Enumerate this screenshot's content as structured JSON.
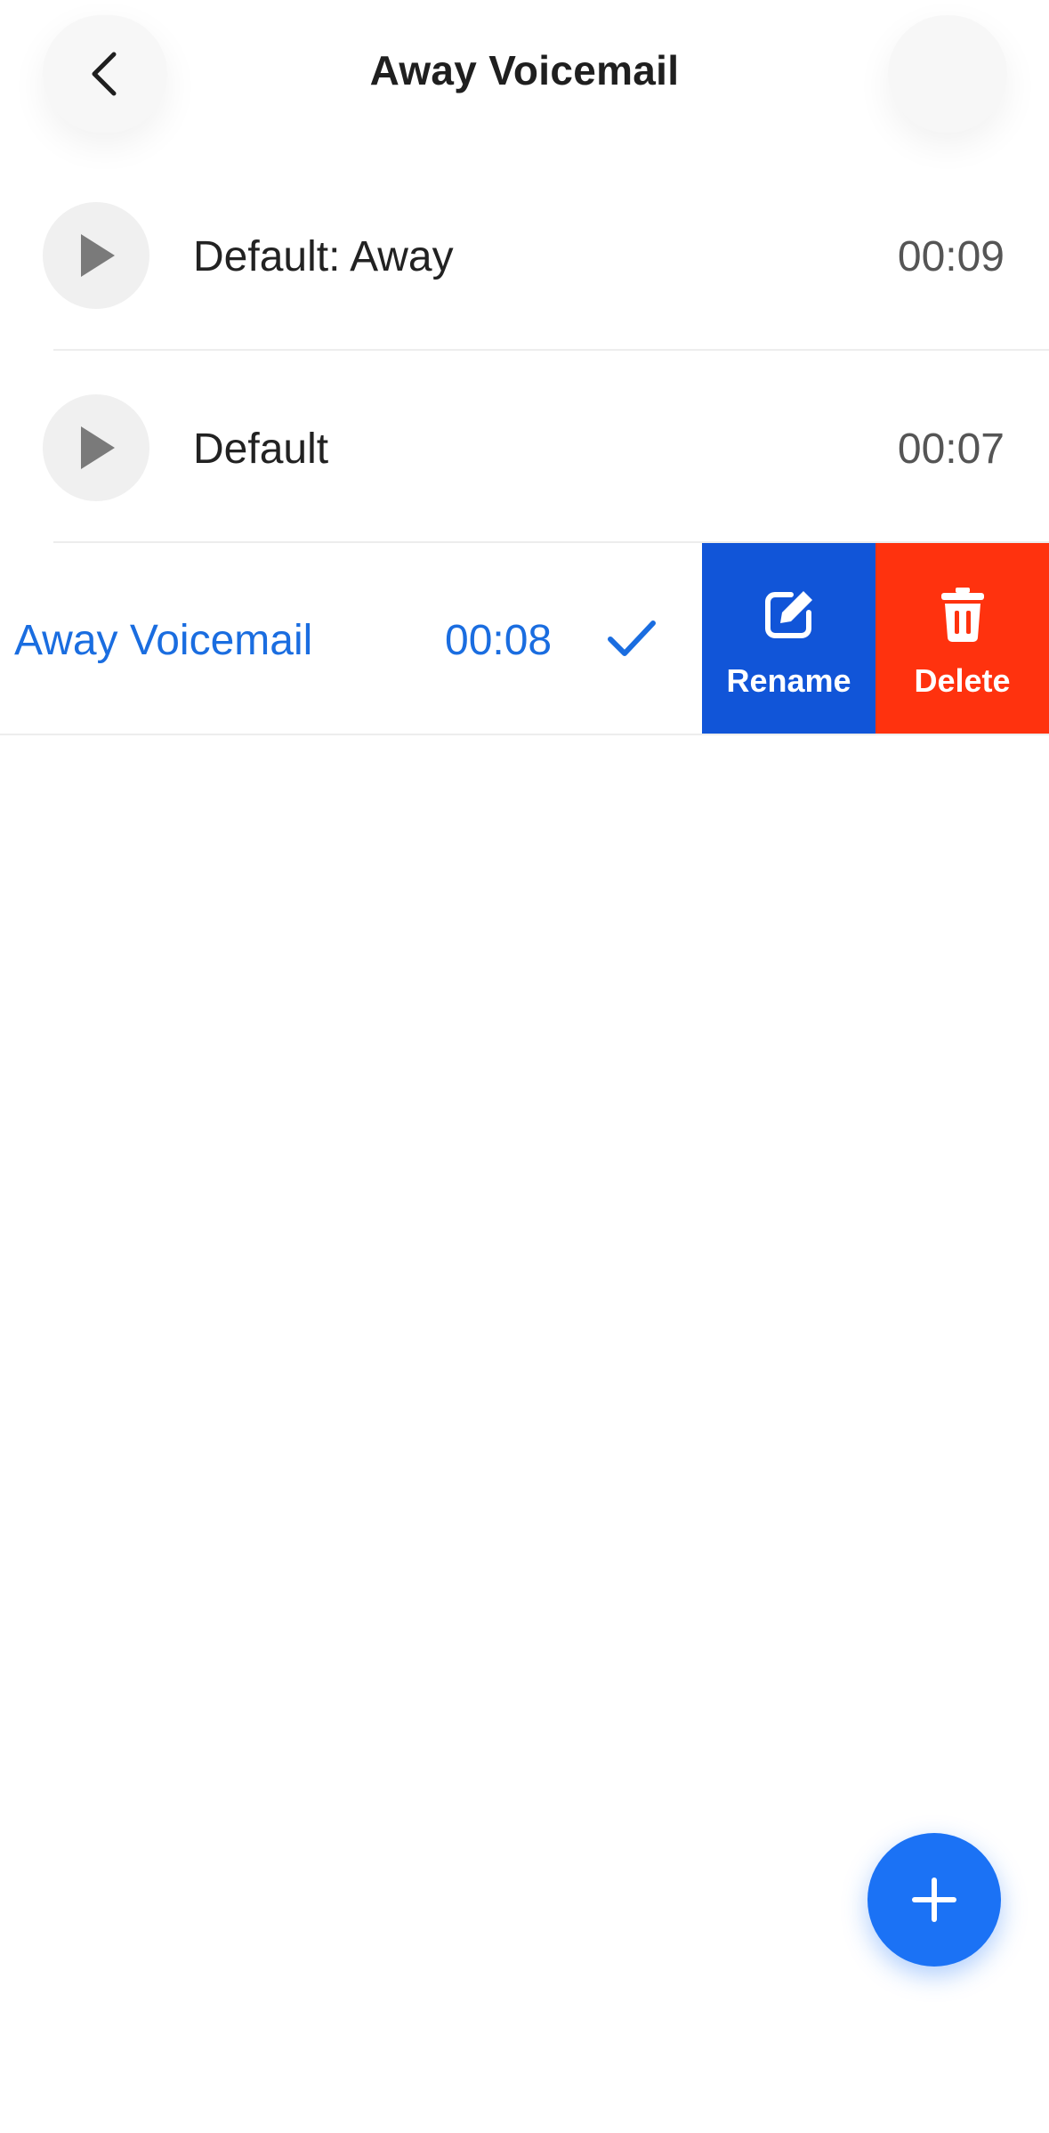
{
  "header": {
    "title": "Away Voicemail",
    "back_icon": "chevron-left-icon"
  },
  "recordings": [
    {
      "name": "Default: Away",
      "duration": "00:09"
    },
    {
      "name": "Default",
      "duration": "00:07"
    }
  ],
  "swiped_recording": {
    "name": "Away Voicemail",
    "duration": "00:08",
    "selected": true,
    "actions": {
      "rename_label": "Rename",
      "delete_label": "Delete"
    }
  },
  "fab": {
    "icon": "plus-icon"
  },
  "colors": {
    "accent": "#1b72f5",
    "selected_text": "#1a6de0",
    "rename": "#1155d8",
    "delete": "#ff320e"
  }
}
